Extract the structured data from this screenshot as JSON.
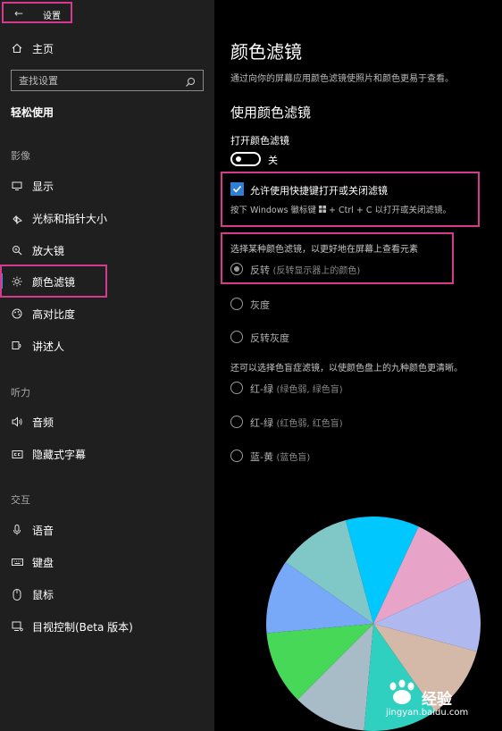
{
  "window": {
    "title": "设置",
    "back_icon": "back-arrow-icon"
  },
  "sidebar": {
    "home_label": "主页",
    "search_placeholder": "查找设置",
    "category_title": "轻松使用",
    "sections": [
      {
        "label": "影像",
        "items": [
          "显示",
          "光标和指针大小",
          "放大镜",
          "颜色滤镜",
          "高对比度",
          "讲述人"
        ]
      },
      {
        "label": "听力",
        "items": [
          "音频",
          "隐藏式字幕"
        ]
      },
      {
        "label": "交互",
        "items": [
          "语音",
          "键盘",
          "鼠标",
          "目视控制(Beta 版本)"
        ]
      }
    ],
    "active_item": "颜色滤镜"
  },
  "main": {
    "title": "颜色滤镜",
    "description": "通过向你的屏幕应用颜色滤镜使照片和颜色更易于查看。",
    "subtitle": "使用颜色滤镜",
    "toggle_label": "打开颜色滤镜",
    "toggle_state": "关",
    "toggle_on": false,
    "shortcut_checkbox_label": "允许使用快捷键打开或关闭滤镜",
    "shortcut_checkbox_checked": true,
    "shortcut_hint_before": "按下 Windows 徽标键",
    "shortcut_hint_after": "+ Ctrl + C 以打开或关闭滤镜。",
    "choose_label": "选择某种颜色滤镜，以更好地在屏幕上查看元素",
    "filters": [
      {
        "name": "反转",
        "note": "(反转显示器上的颜色)",
        "selected": true
      },
      {
        "name": "灰度",
        "note": "",
        "selected": false
      },
      {
        "name": "反转灰度",
        "note": "",
        "selected": false
      }
    ],
    "also_label": "还可以选择色盲症滤镜，以使颜色盘上的九种颜色更清晰。",
    "colorblind_filters": [
      {
        "name": "红-绿",
        "note": "(绿色弱, 绿色盲)"
      },
      {
        "name": "红-绿",
        "note": "(红色弱, 红色盲)"
      },
      {
        "name": "蓝-黄",
        "note": "(蓝色盲)"
      }
    ],
    "color_wheel": [
      "#00c8ff",
      "#e8a4c8",
      "#b0b8f0",
      "#d4b8a8",
      "#30d0c0",
      "#a8bcc8",
      "#48d858",
      "#78a8f8",
      "#80c8c8"
    ]
  },
  "colors": {
    "accent": "#2f7fd6",
    "highlight_box": "#d63a8e",
    "sidebar_bg": "#1f1f1f",
    "main_bg": "#000000"
  },
  "watermark": {
    "main": "经验",
    "sub": "jingyan.baidu.com"
  }
}
